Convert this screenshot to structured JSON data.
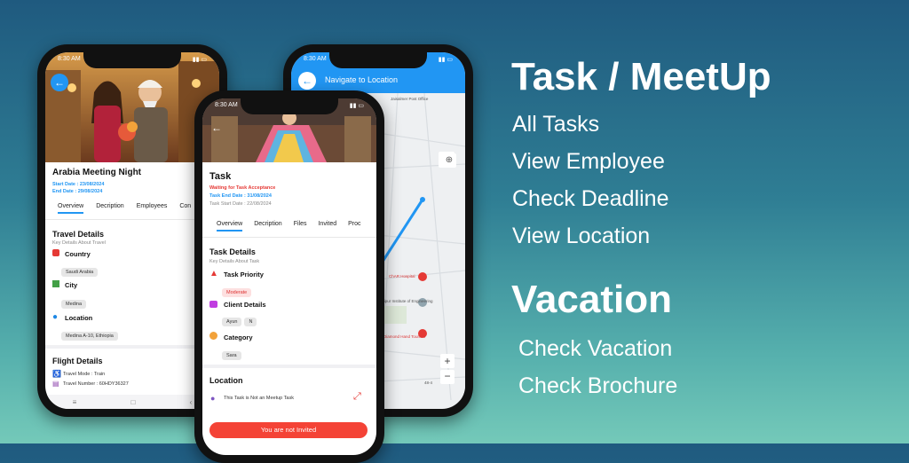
{
  "colors": {
    "accent": "#2196f3",
    "danger": "#f44336",
    "bg_top": "#1f5a7f",
    "bg_bottom": "#74c9b9"
  },
  "phone1": {
    "status_time": "8:30 AM",
    "title": "Arabia Meeting Night",
    "start_date": "Start Date : 23/08/2024",
    "end_date": "End Date : 29/08/2024",
    "tabs": [
      "Overview",
      "Decription",
      "Employees",
      "Con"
    ],
    "travel": {
      "title": "Travel Details",
      "subtitle": "Key Details About Travel",
      "country_label": "Country",
      "country_value": "Saudi Arabia",
      "city_label": "City",
      "city_value": "Medina",
      "location_label": "Location",
      "location_value": "Medina A-10, Ethiopia"
    },
    "flight": {
      "title": "Flight Details",
      "mode": "Travel Mode : Train",
      "number": "Travel Number : 60HDY36327"
    }
  },
  "phone2": {
    "status_time": "8:30 AM",
    "title": "Navigate to Location",
    "map_labels": [
      "Jaisalmer Post Office",
      "ChAR Hospital",
      "Jaipur Institute of Engineering",
      "Diamond Hand Tourism",
      "48-4"
    ]
  },
  "phone3": {
    "status_time": "8:30 AM",
    "title": "Task",
    "status": "Waiting for Task Acceptance",
    "end_date": "Task End Date : 31/08/2024",
    "start_date": "Task Start Date : 22/08/2024",
    "tabs": [
      "Overview",
      "Decription",
      "Files",
      "Invited",
      "Proc"
    ],
    "details_title": "Task Details",
    "details_sub": "Key Details About Task",
    "priority_label": "Task Priority",
    "priority_value": "Moderate",
    "client_label": "Client Details",
    "client_values": [
      "Ayun",
      "N"
    ],
    "category_label": "Category",
    "category_value": "Sara",
    "location_title": "Location",
    "location_note": "This Task is Not an Meetup Task",
    "invite_button": "You are not Invited"
  },
  "features": {
    "heading1": "Task / MeetUp",
    "items1": [
      "All Tasks",
      "View Employee",
      "Check Deadline",
      "View Location"
    ],
    "heading2": "Vacation",
    "items2": [
      "Check Vacation",
      "Check Brochure"
    ]
  }
}
